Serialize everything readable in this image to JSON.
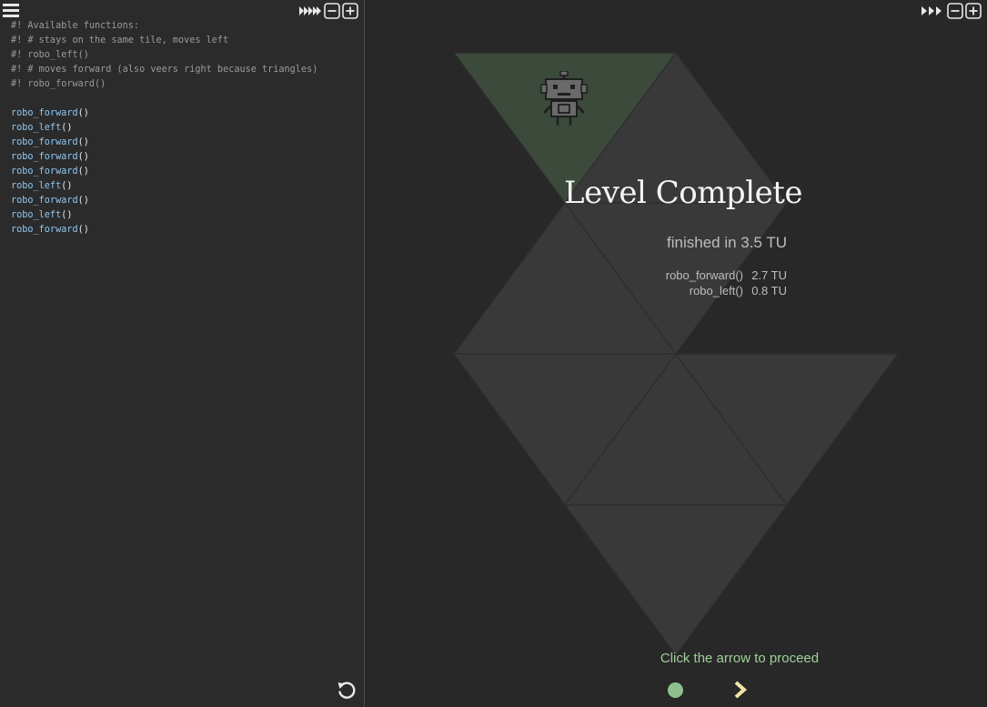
{
  "editor": {
    "code_lines": [
      {
        "kind": "comment",
        "text": "#! Available functions:"
      },
      {
        "kind": "comment",
        "text": "#! # stays on the same tile, moves left"
      },
      {
        "kind": "comment",
        "text": "#! robo_left()"
      },
      {
        "kind": "comment",
        "text": "#! # moves forward (also veers right because triangles)"
      },
      {
        "kind": "comment",
        "text": "#! robo_forward()"
      },
      {
        "kind": "blank",
        "text": ""
      },
      {
        "kind": "call",
        "fn": "robo_forward",
        "args": "()"
      },
      {
        "kind": "call",
        "fn": "robo_left",
        "args": "()"
      },
      {
        "kind": "call",
        "fn": "robo_forward",
        "args": "()"
      },
      {
        "kind": "call",
        "fn": "robo_forward",
        "args": "()"
      },
      {
        "kind": "call",
        "fn": "robo_forward",
        "args": "()"
      },
      {
        "kind": "call",
        "fn": "robo_left",
        "args": "()"
      },
      {
        "kind": "call",
        "fn": "robo_forward",
        "args": "()"
      },
      {
        "kind": "call",
        "fn": "robo_left",
        "args": "()"
      },
      {
        "kind": "call",
        "fn": "robo_forward",
        "args": "()"
      }
    ],
    "icons": {
      "menu": "hamburger-menu-icon",
      "speed": "fast-forward-icon",
      "zoom_out": "zoom-out-icon",
      "zoom_in": "zoom-in-icon",
      "reset": "reset-icon"
    }
  },
  "game": {
    "result": {
      "title": "Level Complete",
      "finished_text": "finished in 3.5 TU",
      "breakdown": [
        {
          "name": "robo_forward()",
          "value": "2.7 TU"
        },
        {
          "name": "robo_left()",
          "value": "0.8 TU"
        }
      ]
    },
    "proceed_text": "Click the arrow to proceed",
    "icons": {
      "speed": "fast-forward-icon",
      "zoom_out": "zoom-out-icon",
      "zoom_in": "zoom-in-icon",
      "robot": "robot-sprite",
      "progress": "progress-dot",
      "next": "next-arrow-icon"
    },
    "colors": {
      "goal_tile": "#3b4a3b",
      "tile": "#3a3a3a",
      "tile_edge": "#2e2e2e",
      "accent_green": "#9fcf9a",
      "arrow": "#f0e6a8"
    }
  }
}
